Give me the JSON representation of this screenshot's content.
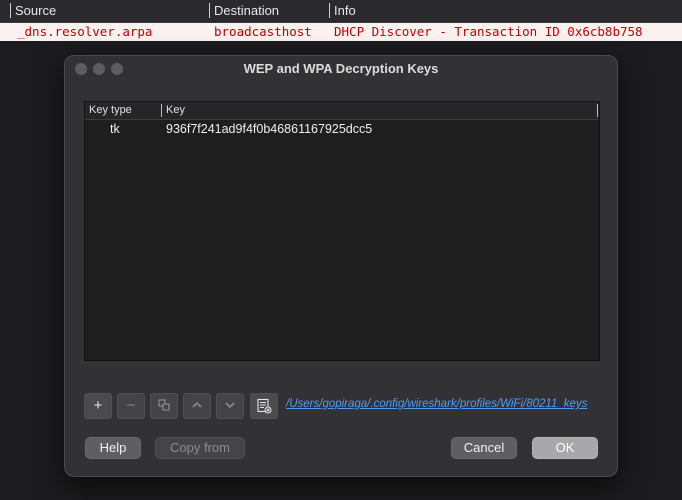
{
  "packet_list": {
    "columns": [
      "Source",
      "Destination",
      "Info"
    ],
    "row": {
      "source": "_dns.resolver.arpa",
      "destination": "broadcasthost",
      "info": "DHCP Discover - Transaction ID 0x6cb8b758"
    }
  },
  "dialog": {
    "title": "WEP and WPA Decryption Keys",
    "table": {
      "headers": [
        "Key type",
        "Key"
      ],
      "rows": [
        {
          "key_type": "tk",
          "key": "936f7f241ad9f4f0b46861167925dcc5"
        }
      ]
    },
    "toolbar": {
      "add_label": "+",
      "remove_label": "−",
      "copy_icon": "copy-icon",
      "move_up_icon": "chevron-up-icon",
      "move_down_icon": "chevron-down-icon",
      "clear_icon": "clear-list-icon"
    },
    "file_path": "/Users/gopiraga/.config/wireshark/profiles/WiFi/80211_keys",
    "buttons": {
      "help": "Help",
      "copy_from": "Copy from",
      "cancel": "Cancel",
      "ok": "OK"
    }
  }
}
